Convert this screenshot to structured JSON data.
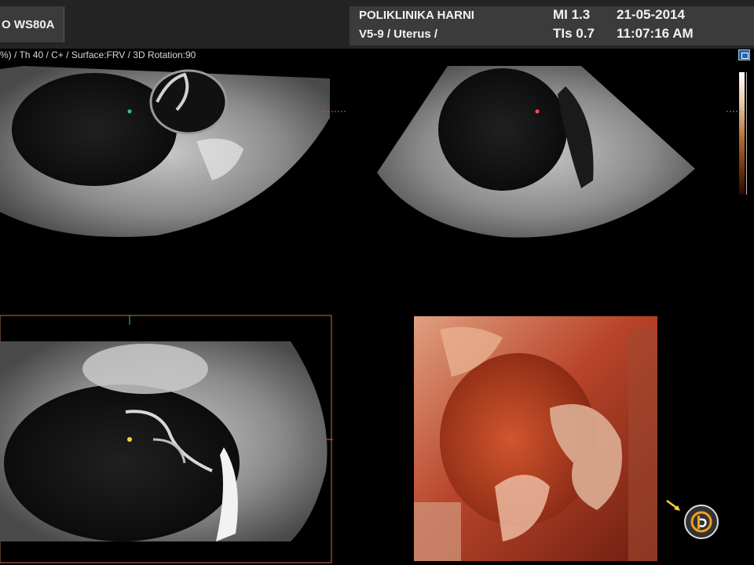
{
  "header": {
    "model": "O WS80A",
    "clinic": "POLIKLINIKA HARNI",
    "probe_preset": "V5-9 / Uterus /",
    "mi": "MI  1.3",
    "tis": "TIs 0.7",
    "date": "21-05-2014",
    "time": "11:07:16 AM"
  },
  "params": "%) / Th 40 / C+ / Surface:FRV / 3D Rotation:90",
  "colors": {
    "header_bg": "#242424",
    "panel_bg": "#3b3b3b",
    "render_orange": "#c0502a",
    "frame_line": "#c0704a",
    "marker_green": "#2ecc71",
    "marker_red": "#ff4d4d",
    "marker_yellow": "#ffd23a"
  },
  "icons": {
    "menu": "menu-icon",
    "logo": "brand-logo-icon",
    "arrow": "pointer-arrow-icon"
  }
}
